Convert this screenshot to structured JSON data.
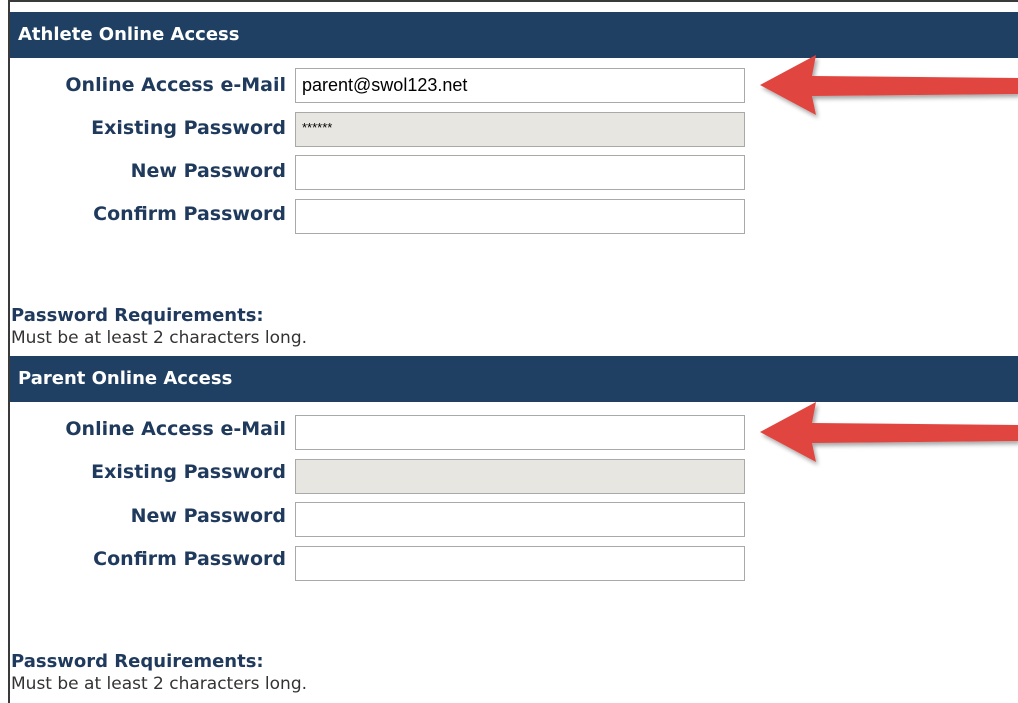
{
  "athlete_section": {
    "title": "Athlete Online Access",
    "email_label": "Online Access e-Mail",
    "email_value": "parent@swol123.net",
    "existing_password_label": "Existing Password",
    "existing_password_value": "******",
    "new_password_label": "New Password",
    "new_password_value": "",
    "confirm_password_label": "Confirm Password",
    "confirm_password_value": "",
    "requirements_title": "Password Requirements:",
    "requirements_text": "Must be at least 2 characters long."
  },
  "parent_section": {
    "title": "Parent Online Access",
    "email_label": "Online Access e-Mail",
    "email_value": "",
    "existing_password_label": "Existing Password",
    "existing_password_value": "",
    "new_password_label": "New Password",
    "new_password_value": "",
    "confirm_password_label": "Confirm Password",
    "confirm_password_value": "",
    "requirements_title": "Password Requirements:",
    "requirements_text": "Must be at least 2 characters long."
  },
  "colors": {
    "header_bg": "#1f4063",
    "label_text": "#1f3a5c",
    "arrow": "#e0453f",
    "readonly_bg": "#e8e6e0"
  },
  "icons": {
    "annotation_arrow": "left-arrow-icon"
  }
}
